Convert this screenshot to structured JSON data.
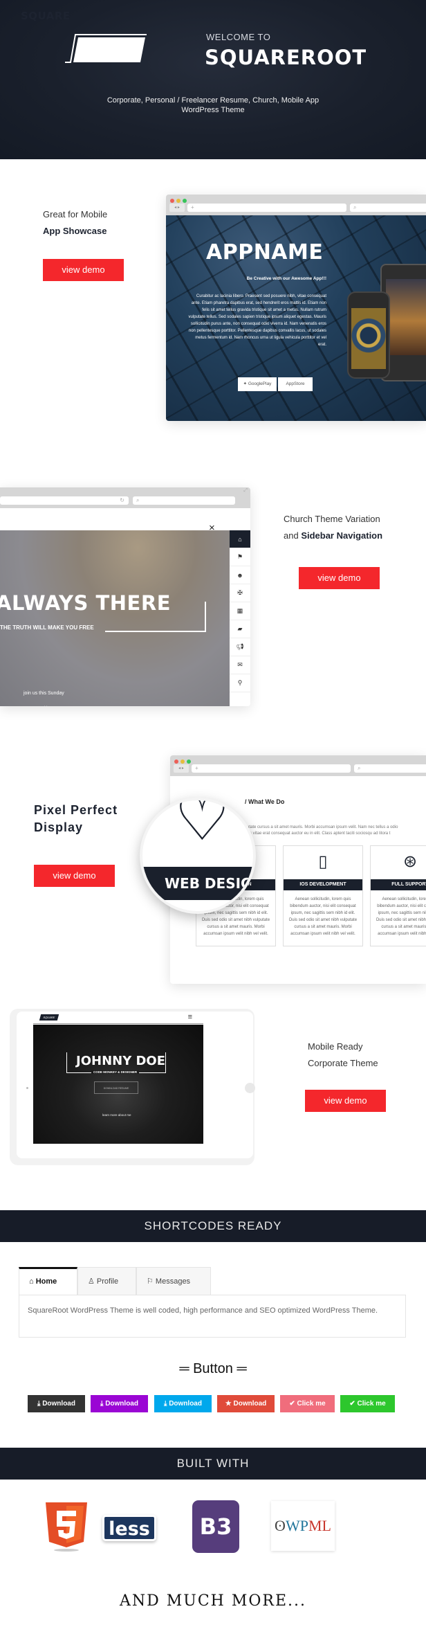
{
  "hero": {
    "logo_text": "SQUARE",
    "welcome": "WELCOME TO",
    "brand": "SQUAREROOT",
    "tagline_line1": "Corporate, Personal / Freelancer Resume, Church, Mobile App",
    "tagline_line2": "WordPress Theme"
  },
  "features": {
    "app": {
      "line1": "Great for Mobile",
      "line2": "App Showcase",
      "button": "view demo",
      "mockup": {
        "title": "APPNAME",
        "subtitle": "Be Creative with our Awesome App!!!",
        "body": "Curabitur ac lacinia libero. Praesent sed posuere nibh, vitae consequat ante. Etiam pharetra dapibus erat, sed hendrerit eros mattis id. Etiam non felis sit amet tellus gravida tristique sit amet a metus. Nullam rutrum vulputate tellus. Sed sodales sapien tristique ipsum aliquet egestas. Mauris sollicitudin purus ante, non consequat odio viverra id. Nam venenatis eros non pellentesque porttitor. Pellentesque dapibus convallis lacus, ut sodales metus fermentum id. Nam rhoncus urna ut ligula vehicula porttitor et vel erat.",
        "google_play": "GooglePlay",
        "app_store": "AppStore"
      }
    },
    "church": {
      "line1": "Church Theme Variation",
      "line2_prefix": "and ",
      "line2_bold": "Sidebar Navigation",
      "button": "view demo",
      "mockup": {
        "title": "ALWAYS THERE",
        "subtitle": "THE TRUTH WILL MAKE YOU FREE",
        "join": "join us this Sunday",
        "close": "×",
        "nav_icons": [
          "home-icon",
          "flag-icon",
          "users-icon",
          "gift-icon",
          "calendar-icon",
          "book-icon",
          "bullhorn-icon",
          "envelope-icon",
          "map-marker-icon"
        ]
      }
    },
    "pixel": {
      "line1": "Pixel Perfect",
      "line2": "Display",
      "button": "view demo",
      "mockup": {
        "section_title": "What We Do",
        "intro1": "vulputate cursus a sit amet mauris. Morbi accumsan ipsum velit. Nam nec tellus a odio",
        "intro2": "mauris vitae erat consequat auctor eu in elit. Class aptent taciti sociosqu ad litora t",
        "magnified_title": "WEB DESIGN",
        "cards": [
          {
            "title": "WEB DESIGN",
            "icon": "heart-icon",
            "body": "Aenean sollicitudin, lorem quis bibendum auctor, nisi elit consequat ipsum, nec sagittis sem nibh id elit. Duis sed odio sit amet nibh vulputate cursus a sit amet mauris. Morbi accumsan ipsum velit nibh vel velit."
          },
          {
            "title": "IOS DEVELOPMENT",
            "icon": "mobile-icon",
            "body": "Aenean sollicitudin, lorem quis bibendum auctor, nisi elit consequat ipsum, nec sagittis sem nibh id elit. Duis sed odio sit amet nibh vulputate cursus a sit amet mauris. Morbi accumsan ipsum velit nibh vel velit."
          },
          {
            "title": "FULL SUPPORT",
            "icon": "life-ring-icon",
            "body": "Aenean sollicitudin, lorem quis bibendum auctor, nisi elit consequat ipsum, nec sagittis sem nibh id elit. Duis sed odio sit amet nibh vulputate cursus a sit amet mauris. Morbi accumsan ipsum velit nibh vel velit."
          }
        ]
      }
    },
    "mobile": {
      "line1": "Mobile Ready",
      "line2": "Corporate Theme",
      "button": "view demo",
      "mockup": {
        "logo": "SQUARE",
        "name": "JOHNNY DOE",
        "role": "CODE MONKEY & DESIGNER",
        "cta": "DOWNLOAD RESUME",
        "learn": "learn more about me"
      }
    }
  },
  "shortcodes": {
    "title": "SHORTCODES READY",
    "tabs": [
      {
        "label": "Home",
        "icon": "home-icon",
        "active": true
      },
      {
        "label": "Profile",
        "icon": "user-icon",
        "active": false
      },
      {
        "label": "Messages",
        "icon": "flag-icon",
        "active": false
      }
    ],
    "panel_text": "SquareRoot WordPress Theme is well coded, high performance and SEO optimized WordPress Theme.",
    "button_heading": "═ Button ═",
    "buttons": [
      {
        "label": "Download",
        "icon": "download-icon",
        "color": "#333333"
      },
      {
        "label": "Download",
        "icon": "download-icon",
        "color": "#9a06d4"
      },
      {
        "label": "Download",
        "icon": "download-icon",
        "color": "#00a8ec"
      },
      {
        "label": "Download",
        "icon": "star-icon",
        "color": "#e04b3a"
      },
      {
        "label": "Click me",
        "icon": "check-icon",
        "color": "#f06d7c"
      },
      {
        "label": "Click me",
        "icon": "check-icon",
        "color": "#2dc72d"
      }
    ]
  },
  "built_with": {
    "title": "BUILT WITH",
    "logos": [
      "HTML5",
      "less",
      "B3",
      "WPML"
    ],
    "more": "AND MUCH MORE..."
  },
  "colors": {
    "accent": "#f4272c",
    "dark": "#171c28"
  }
}
